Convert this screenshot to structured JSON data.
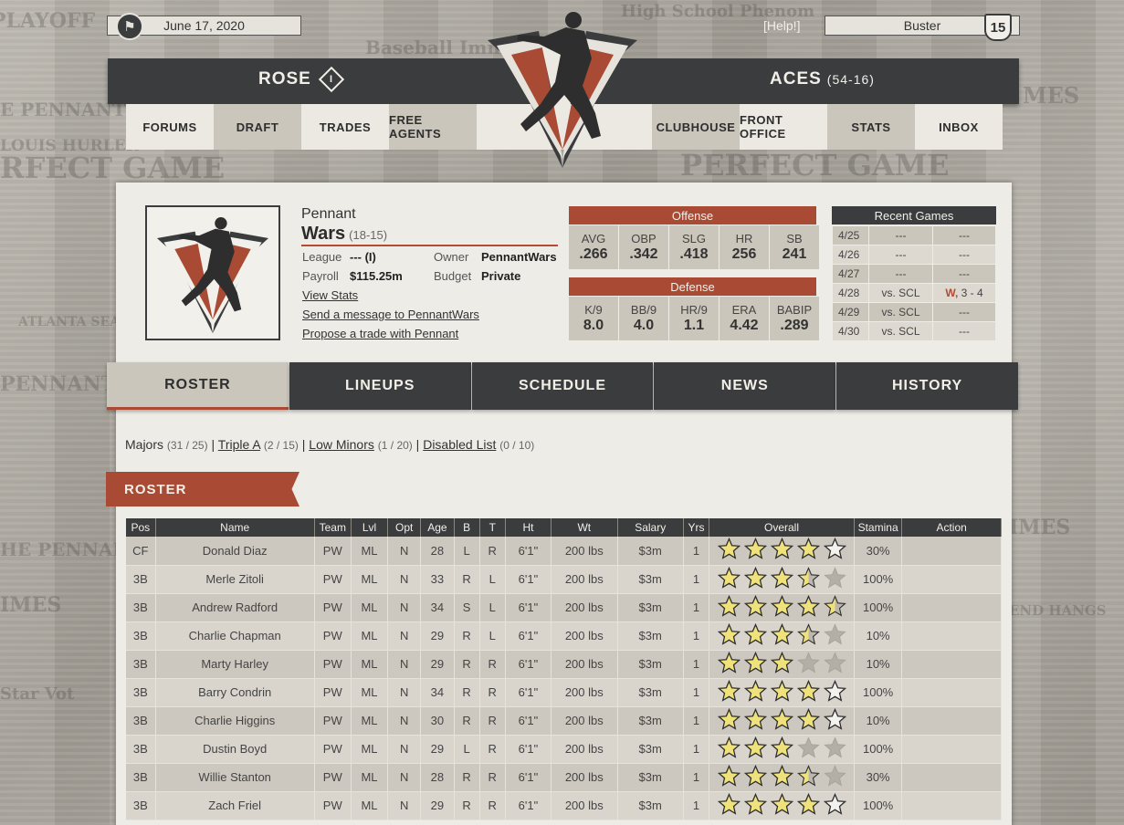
{
  "top": {
    "date": "June 17, 2020",
    "help": "[Help!]",
    "user": "Buster",
    "notification_count": "15"
  },
  "header": {
    "team_left": "ROSE",
    "team_left_rank": "I",
    "team_right": "ACES",
    "team_right_record": "(54-16)"
  },
  "nav": {
    "left": [
      "FORUMS",
      "DRAFT",
      "TRADES",
      "FREE AGENTS"
    ],
    "right": [
      "CLUBHOUSE",
      "FRONT OFFICE",
      "STATS",
      "INBOX"
    ]
  },
  "team": {
    "city": "Pennant",
    "name": "Wars",
    "record": "(18-15)",
    "league_label": "League",
    "league_value": "--- (I)",
    "owner_label": "Owner",
    "owner_value": "PennantWars",
    "payroll_label": "Payroll",
    "payroll_value": "$115.25m",
    "budget_label": "Budget",
    "budget_value": "Private",
    "link_stats": "View Stats",
    "link_message": "Send a message to PennantWars",
    "link_trade": "Propose a trade with Pennant"
  },
  "offense": {
    "title": "Offense",
    "stats": [
      {
        "k": "AVG",
        "v": ".266"
      },
      {
        "k": "OBP",
        "v": ".342"
      },
      {
        "k": "SLG",
        "v": ".418"
      },
      {
        "k": "HR",
        "v": "256"
      },
      {
        "k": "SB",
        "v": "241"
      }
    ]
  },
  "defense": {
    "title": "Defense",
    "stats": [
      {
        "k": "K/9",
        "v": "8.0"
      },
      {
        "k": "BB/9",
        "v": "4.0"
      },
      {
        "k": "HR/9",
        "v": "1.1"
      },
      {
        "k": "ERA",
        "v": "4.42"
      },
      {
        "k": "BABIP",
        "v": ".289"
      }
    ]
  },
  "recent_games": {
    "title": "Recent Games",
    "rows": [
      {
        "date": "4/25",
        "opp": "---",
        "result": "---",
        "win": ""
      },
      {
        "date": "4/26",
        "opp": "---",
        "result": "---",
        "win": ""
      },
      {
        "date": "4/27",
        "opp": "---",
        "result": "---",
        "win": ""
      },
      {
        "date": "4/28",
        "opp": "vs. SCL",
        "result": "3 - 4",
        "win": "W,"
      },
      {
        "date": "4/29",
        "opp": "vs. SCL",
        "result": "---",
        "win": ""
      },
      {
        "date": "4/30",
        "opp": "vs. SCL",
        "result": "---",
        "win": ""
      }
    ]
  },
  "tabs": [
    "ROSTER",
    "LINEUPS",
    "SCHEDULE",
    "NEWS",
    "HISTORY"
  ],
  "subnav": {
    "majors": "Majors",
    "majors_count": "(31 / 25)",
    "triple_a": "Triple A",
    "triple_a_count": "(2 / 15)",
    "low_minors": "Low Minors",
    "low_minors_count": "(1 / 20)",
    "disabled": "Disabled List",
    "disabled_count": "(0 / 10)"
  },
  "roster_title": "ROSTER",
  "roster_columns": [
    "Pos",
    "Name",
    "Team",
    "Lvl",
    "Opt",
    "Age",
    "B",
    "T",
    "Ht",
    "Wt",
    "Salary",
    "Yrs",
    "Overall",
    "Stamina",
    "Action"
  ],
  "roster": [
    {
      "pos": "CF",
      "name": "Donald Diaz",
      "team": "PW",
      "lvl": "ML",
      "opt": "N",
      "age": "28",
      "b": "L",
      "t": "R",
      "ht": "6'1\"",
      "wt": "200 lbs",
      "salary": "$3m",
      "yrs": "1",
      "overall": 4,
      "stamina": "30%"
    },
    {
      "pos": "3B",
      "name": "Merle Zitoli",
      "team": "PW",
      "lvl": "ML",
      "opt": "N",
      "age": "33",
      "b": "R",
      "t": "L",
      "ht": "6'1\"",
      "wt": "200 lbs",
      "salary": "$3m",
      "yrs": "1",
      "overall": 3.5,
      "stamina": "100%"
    },
    {
      "pos": "3B",
      "name": "Andrew Radford",
      "team": "PW",
      "lvl": "ML",
      "opt": "N",
      "age": "34",
      "b": "S",
      "t": "L",
      "ht": "6'1\"",
      "wt": "200 lbs",
      "salary": "$3m",
      "yrs": "1",
      "overall": 4.5,
      "stamina": "100%"
    },
    {
      "pos": "3B",
      "name": "Charlie Chapman",
      "team": "PW",
      "lvl": "ML",
      "opt": "N",
      "age": "29",
      "b": "R",
      "t": "L",
      "ht": "6'1\"",
      "wt": "200 lbs",
      "salary": "$3m",
      "yrs": "1",
      "overall": 3.5,
      "stamina": "10%"
    },
    {
      "pos": "3B",
      "name": "Marty Harley",
      "team": "PW",
      "lvl": "ML",
      "opt": "N",
      "age": "29",
      "b": "R",
      "t": "R",
      "ht": "6'1\"",
      "wt": "200 lbs",
      "salary": "$3m",
      "yrs": "1",
      "overall": 3,
      "stamina": "10%"
    },
    {
      "pos": "3B",
      "name": "Barry Condrin",
      "team": "PW",
      "lvl": "ML",
      "opt": "N",
      "age": "34",
      "b": "R",
      "t": "R",
      "ht": "6'1\"",
      "wt": "200 lbs",
      "salary": "$3m",
      "yrs": "1",
      "overall": 4,
      "stamina": "100%"
    },
    {
      "pos": "3B",
      "name": "Charlie Higgins",
      "team": "PW",
      "lvl": "ML",
      "opt": "N",
      "age": "30",
      "b": "R",
      "t": "R",
      "ht": "6'1\"",
      "wt": "200 lbs",
      "salary": "$3m",
      "yrs": "1",
      "overall": 4,
      "stamina": "10%"
    },
    {
      "pos": "3B",
      "name": "Dustin Boyd",
      "team": "PW",
      "lvl": "ML",
      "opt": "N",
      "age": "29",
      "b": "L",
      "t": "R",
      "ht": "6'1\"",
      "wt": "200 lbs",
      "salary": "$3m",
      "yrs": "1",
      "overall": 3,
      "stamina": "100%"
    },
    {
      "pos": "3B",
      "name": "Willie Stanton",
      "team": "PW",
      "lvl": "ML",
      "opt": "N",
      "age": "28",
      "b": "R",
      "t": "R",
      "ht": "6'1\"",
      "wt": "200 lbs",
      "salary": "$3m",
      "yrs": "1",
      "overall": 3.5,
      "stamina": "30%"
    },
    {
      "pos": "3B",
      "name": "Zach Friel",
      "team": "PW",
      "lvl": "ML",
      "opt": "N",
      "age": "29",
      "b": "R",
      "t": "R",
      "ht": "6'1\"",
      "wt": "200 lbs",
      "salary": "$3m",
      "yrs": "1",
      "overall": 4,
      "stamina": "100%"
    }
  ]
}
